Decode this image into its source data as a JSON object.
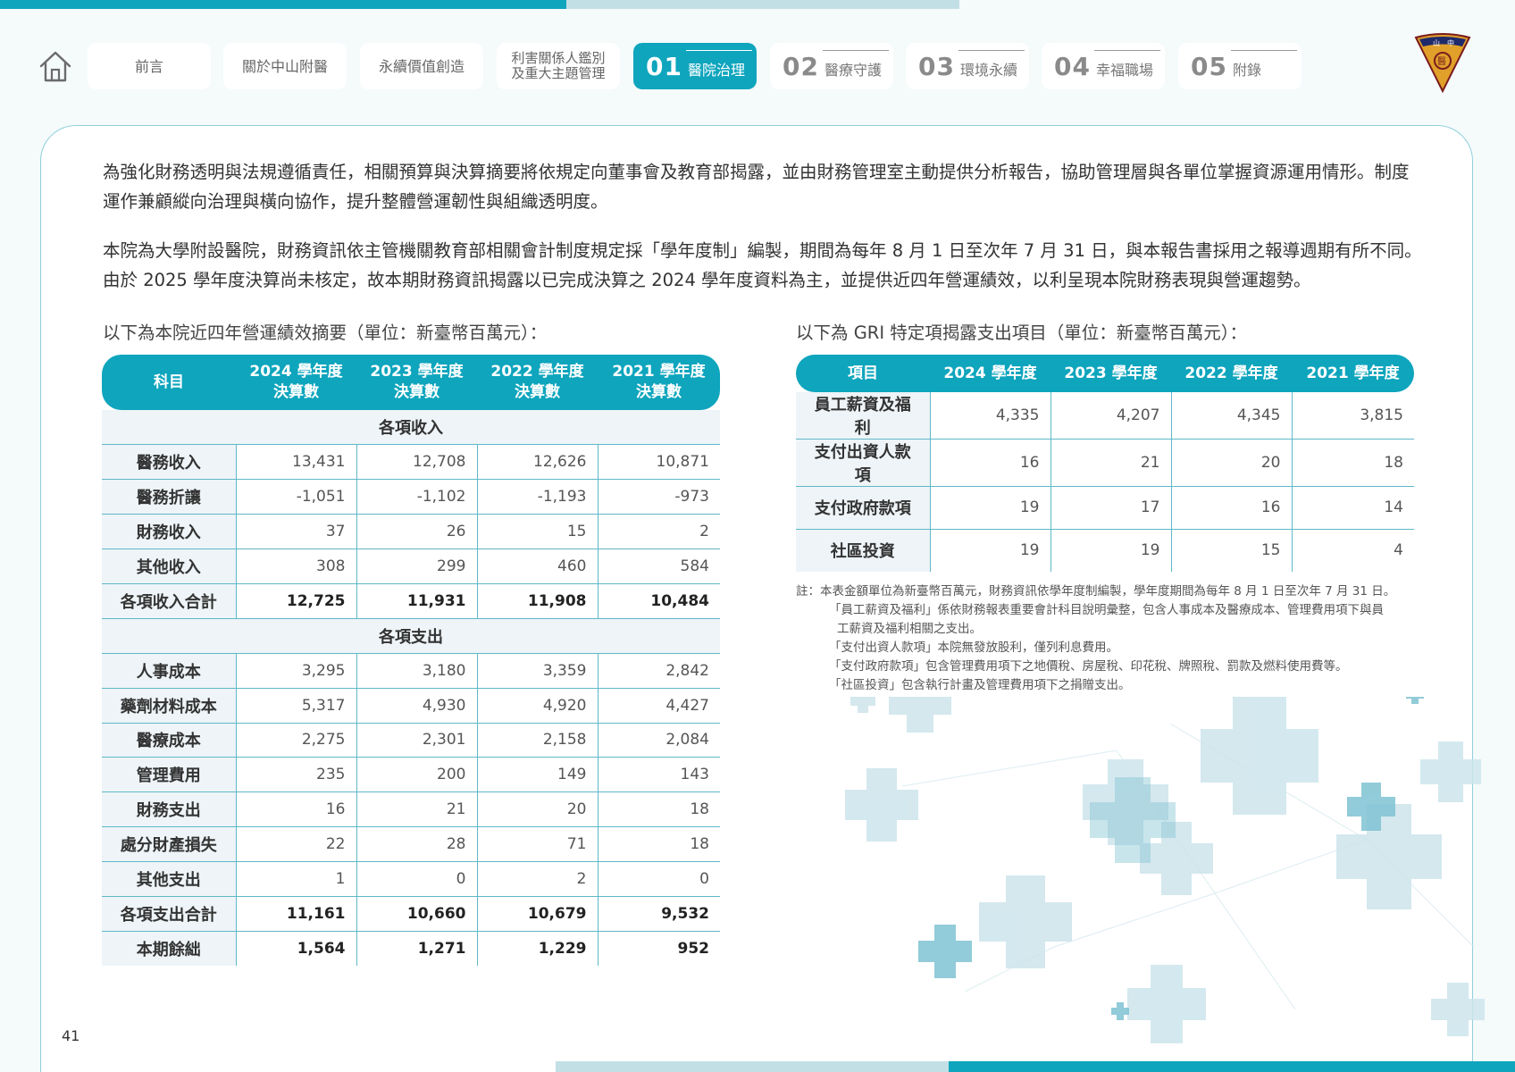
{
  "nav": {
    "tabs": [
      {
        "label": "前言"
      },
      {
        "label": "關於中山附醫"
      },
      {
        "label": "永續價值創造"
      },
      {
        "label_line1": "利害關係人鑑別",
        "label_line2": "及重大主題管理"
      },
      {
        "num": "01",
        "label": "醫院治理"
      },
      {
        "num": "02",
        "label": "醫療守護"
      },
      {
        "num": "03",
        "label": "環境永續"
      },
      {
        "num": "04",
        "label": "幸福職場"
      },
      {
        "num": "05",
        "label": "附錄"
      }
    ],
    "logo_text": "山中醫"
  },
  "intro": {
    "p1": "為強化財務透明與法規遵循責任，相關預算與決算摘要將依規定向董事會及教育部揭露，並由財務管理室主動提供分析報告，協助管理層與各單位掌握資源運用情形。制度運作兼顧縱向治理與橫向協作，提升整體營運韌性與組織透明度。",
    "p2": "本院為大學附設醫院，財務資訊依主管機關教育部相關會計制度規定採「學年度制」編製，期間為每年 8 月 1 日至次年 7 月 31 日，與本報告書採用之報導週期有所不同。由於 2025 學年度決算尚未核定，故本期財務資訊揭露以已完成決算之 2024 學年度資料為主，並提供近四年營運績效，以利呈現本院財務表現與營運趨勢。"
  },
  "table1": {
    "caption": "以下為本院近四年營運績效摘要（單位：新臺幣百萬元）：",
    "headers": {
      "subject": "科目",
      "c1a": "2024 學年度",
      "c1b": "決算數",
      "c2a": "2023 學年度",
      "c2b": "決算數",
      "c3a": "2022 學年度",
      "c3b": "決算數",
      "c4a": "2021 學年度",
      "c4b": "決算數"
    },
    "income_section": "各項收入",
    "income_rows": [
      {
        "label": "醫務收入",
        "v": [
          "13,431",
          "12,708",
          "12,626",
          "10,871"
        ]
      },
      {
        "label": "醫務折讓",
        "v": [
          "-1,051",
          "-1,102",
          "-1,193",
          "-973"
        ]
      },
      {
        "label": "財務收入",
        "v": [
          "37",
          "26",
          "15",
          "2"
        ]
      },
      {
        "label": "其他收入",
        "v": [
          "308",
          "299",
          "460",
          "584"
        ]
      },
      {
        "label": "各項收入合計",
        "v": [
          "12,725",
          "11,931",
          "11,908",
          "10,484"
        ]
      }
    ],
    "expense_section": "各項支出",
    "expense_rows": [
      {
        "label": "人事成本",
        "v": [
          "3,295",
          "3,180",
          "3,359",
          "2,842"
        ]
      },
      {
        "label": "藥劑材料成本",
        "v": [
          "5,317",
          "4,930",
          "4,920",
          "4,427"
        ]
      },
      {
        "label": "醫療成本",
        "v": [
          "2,275",
          "2,301",
          "2,158",
          "2,084"
        ]
      },
      {
        "label": "管理費用",
        "v": [
          "235",
          "200",
          "149",
          "143"
        ]
      },
      {
        "label": "財務支出",
        "v": [
          "16",
          "21",
          "20",
          "18"
        ]
      },
      {
        "label": "處分財產損失",
        "v": [
          "22",
          "28",
          "71",
          "18"
        ]
      },
      {
        "label": "其他支出",
        "v": [
          "1",
          "0",
          "2",
          "0"
        ]
      },
      {
        "label": "各項支出合計",
        "v": [
          "11,161",
          "10,660",
          "10,679",
          "9,532"
        ]
      },
      {
        "label": "本期餘絀",
        "v": [
          "1,564",
          "1,271",
          "1,229",
          "952"
        ]
      }
    ]
  },
  "table2": {
    "caption": "以下為 GRI 特定項揭露支出項目（單位：新臺幣百萬元）：",
    "headers": [
      "項目",
      "2024 學年度",
      "2023 學年度",
      "2022 學年度",
      "2021 學年度"
    ],
    "rows": [
      {
        "label": "員工薪資及福利",
        "v": [
          "4,335",
          "4,207",
          "4,345",
          "3,815"
        ]
      },
      {
        "label": "支付出資人款項",
        "v": [
          "16",
          "21",
          "20",
          "18"
        ]
      },
      {
        "label": "支付政府款項",
        "v": [
          "19",
          "17",
          "16",
          "14"
        ]
      },
      {
        "label": "社區投資",
        "v": [
          "19",
          "19",
          "15",
          "4"
        ]
      }
    ]
  },
  "notes": {
    "n0": "註：本表金額單位為新臺幣百萬元，財務資訊依學年度制編製，學年度期間為每年 8 月 1 日至次年 7 月 31 日。",
    "n1a": "「員工薪資及福利」係依財務報表重要會計科目說明彙整，包含人事成本及醫療成本、管理費用項下與員",
    "n1b": "工薪資及福利相關之支出。",
    "n2": "「支付出資人款項」本院無發放股利，僅列利息費用。",
    "n3": "「支付政府款項」包含管理費用項下之地價稅、房屋稅、印花稅、牌照稅、罰款及燃料使用費等。",
    "n4": "「社區投資」包含執行計畫及管理費用項下之捐贈支出。"
  },
  "page_number": "41",
  "colors": {
    "accent": "#0ea5bd",
    "light": "#c3dfe6",
    "row_label_bg": "#eef4f7"
  },
  "icons": {
    "home": "home-icon",
    "logo": "hospital-logo"
  }
}
